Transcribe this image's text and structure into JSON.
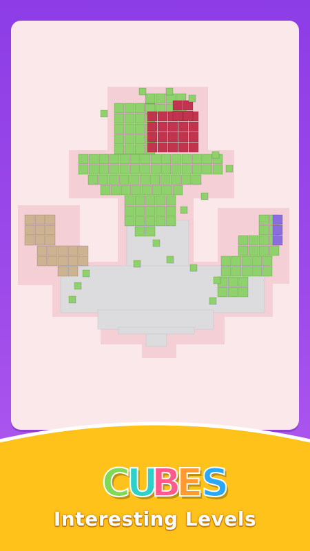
{
  "game": {
    "logo_text": "CUBES",
    "subtitle": "Interesting Levels",
    "logo_letters": [
      {
        "char": "C",
        "color": "#7ed957"
      },
      {
        "char": "U",
        "color": "#2fd0c8"
      },
      {
        "char": "B",
        "color": "#ff5a8a"
      },
      {
        "char": "E",
        "color": "#ff9a2e"
      },
      {
        "char": "S",
        "color": "#2aa7f5"
      }
    ]
  },
  "colors": {
    "background_purple": "#9b46ea",
    "card_pink": "#fbe8ea",
    "cube_green": "#8fd16c",
    "cube_red": "#c2334d",
    "cube_tan": "#cdb391",
    "cube_purple": "#8a6ee0",
    "floor_grey": "#d9d9db",
    "banner_yellow": "#ffc21a"
  },
  "icons": [
    "anchor-puzzle-image",
    "cubes-logo"
  ]
}
